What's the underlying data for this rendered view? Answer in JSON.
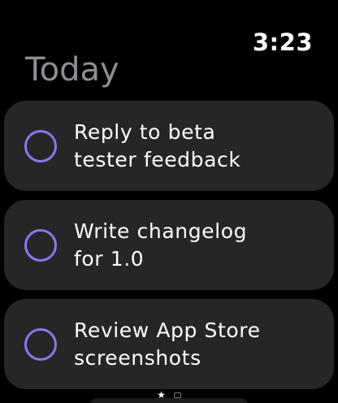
{
  "status": {
    "time": "3:23"
  },
  "header": {
    "title": "Today"
  },
  "tasks": [
    {
      "line1": "Reply to beta",
      "line2": "tester feedback"
    },
    {
      "line1": "Write changelog",
      "line2": "for 1.0"
    },
    {
      "line1": "Review App Store",
      "line2": "screenshots"
    }
  ],
  "pager": {
    "pages": [
      "favorites-star",
      "inbox"
    ],
    "current_page": 1
  },
  "colors": {
    "background": "#000000",
    "card": "#262628",
    "accent": "#8b78f0",
    "title_gray": "#8e8e93"
  }
}
